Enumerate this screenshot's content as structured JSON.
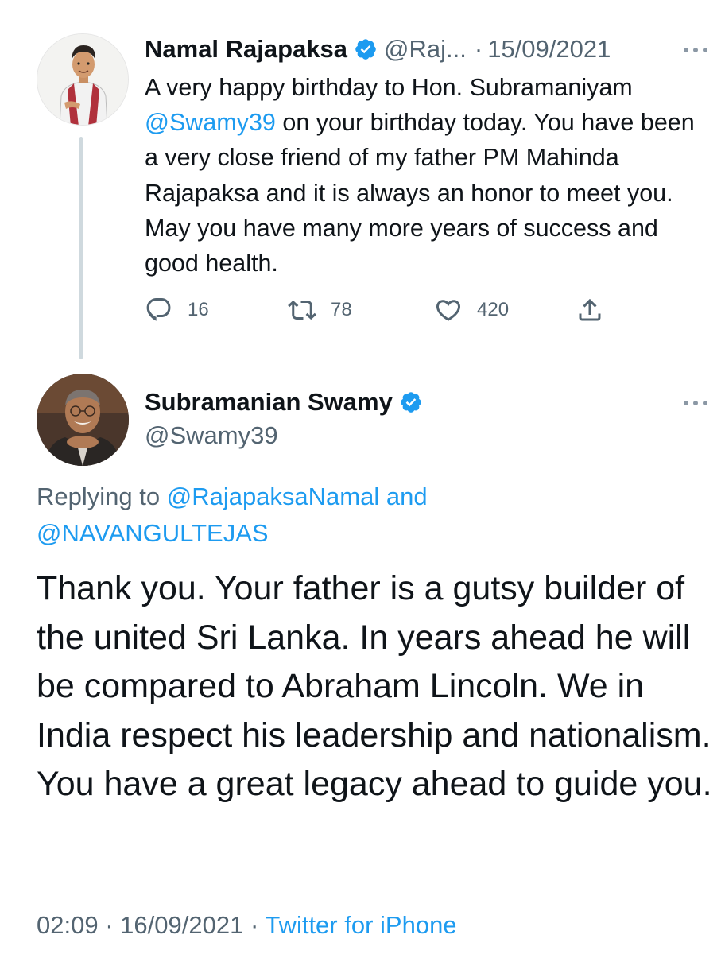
{
  "parent_tweet": {
    "author_name": "Namal Rajapaksa",
    "handle": "@Raj...",
    "separator": "·",
    "date": "15/09/2021",
    "text_line1": "A very happy birthday to Hon. Subramaniyam",
    "mention": "@Swamy39",
    "text_rest": " on your birthday today. You have been a very close friend of my father PM Mahinda Rajapaksa and it is always an honor to meet you. May you have many more years of success and good health.",
    "replies": "16",
    "retweets": "78",
    "likes": "420",
    "icons": [
      "verified-badge-icon",
      "more-icon",
      "reply-icon",
      "retweet-icon",
      "like-icon",
      "share-icon"
    ]
  },
  "reply_tweet": {
    "author_name": "Subramanian Swamy",
    "handle": "@Swamy39",
    "replying_prefix": "Replying to ",
    "replying_mention1": "@RajapaksaNamal",
    "replying_and": " and",
    "replying_mention2": "@NAVANGULTEJAS",
    "text": "Thank you. Your father is a gutsy builder of the united Sri Lanka. In years ahead he will be compared to Abraham Lincoln. We in India respect his leadership and nationalism. You have a great legacy ahead to guide you.",
    "time": "02:09",
    "separator": "·",
    "date": "16/09/2021",
    "source": "Twitter for iPhone"
  },
  "colors": {
    "link": "#1d9bf0",
    "muted": "#536471",
    "text": "#0f1419",
    "thread_line": "#cfd9de"
  }
}
